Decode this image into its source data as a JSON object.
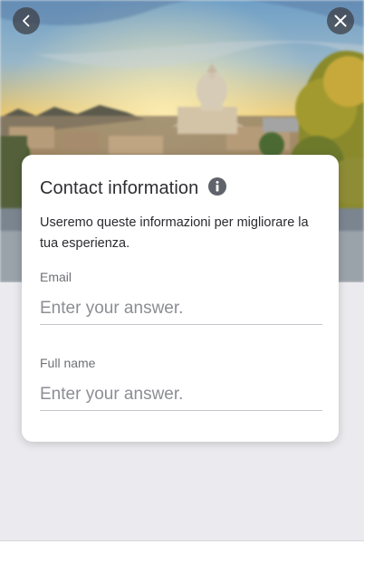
{
  "nav": {
    "back_icon": "chevron-left-icon",
    "close_icon": "close-icon"
  },
  "form": {
    "title": "Contact information",
    "info_icon": "info-icon",
    "description": "Useremo queste informazioni per migliorare la tua esperienza.",
    "fields": [
      {
        "label": "Email",
        "placeholder": "Enter your answer.",
        "value": ""
      },
      {
        "label": "Full name",
        "placeholder": "Enter your answer.",
        "value": ""
      }
    ]
  },
  "colors": {
    "card_background": "#ffffff",
    "page_background": "#ebebef",
    "title_text": "#2e2e33",
    "label_text": "#6f7177",
    "placeholder_text": "#8c8e95",
    "icon_button": "#3c3c42"
  }
}
